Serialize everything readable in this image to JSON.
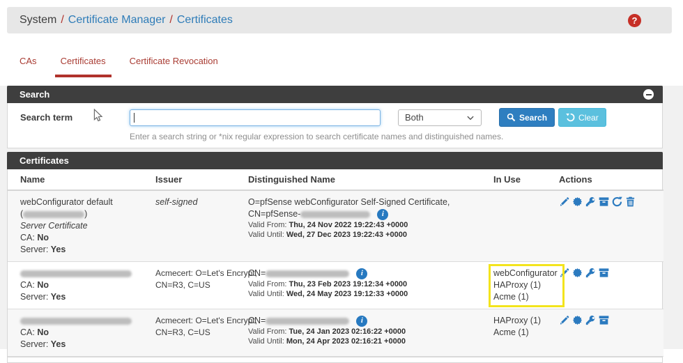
{
  "breadcrumb": {
    "root": "System",
    "separator": "/",
    "link1": "Certificate Manager",
    "link2": "Certificates",
    "help_icon": "?"
  },
  "tabs": {
    "cas": "CAs",
    "certificates": "Certificates",
    "revocation": "Certificate Revocation",
    "active": "Certificates"
  },
  "search": {
    "title": "Search",
    "term_label": "Search term",
    "input_value": "",
    "scope_value": "Both",
    "search_button": "Search",
    "clear_button": "Clear",
    "help_text": "Enter a search string or *nix regular expression to search certificate names and distinguished names."
  },
  "labels": {
    "ca": "CA:",
    "server": "Server:",
    "valid_from": "Valid From:",
    "valid_until": "Valid Until:"
  },
  "table": {
    "title": "Certificates",
    "columns": {
      "name": "Name",
      "issuer": "Issuer",
      "dn": "Distinguished Name",
      "in_use": "In Use",
      "actions": "Actions"
    },
    "rows": [
      {
        "name": "webConfigurator default",
        "paren_open": "(",
        "name_redacted": true,
        "paren_close": ")",
        "type": "Server Certificate",
        "ca_value": "No",
        "server_value": "Yes",
        "issuer": "self-signed",
        "dn_line1": "O=pfSense webConfigurator Self-Signed Certificate,",
        "dn_prefix": "CN=pfSense-",
        "dn_redacted": true,
        "valid_from": "Thu, 24 Nov 2022 19:22:43 +0000",
        "valid_until": "Wed, 27 Dec 2023 19:22:43 +0000",
        "in_use": [],
        "actions": [
          "edit",
          "export-certificate",
          "export-key",
          "export-p12",
          "renew",
          "delete"
        ]
      },
      {
        "name_redacted": true,
        "ca_value": "No",
        "server_value": "Yes",
        "issuer_line1": "Acmecert: O=Let's Encrypt,",
        "issuer_line2": "CN=R3, C=US",
        "dn_prefix": "CN=",
        "dn_redacted": true,
        "valid_from": "Thu, 23 Feb 2023 19:12:34 +0000",
        "valid_until": "Wed, 24 May 2023 19:12:33 +0000",
        "in_use": [
          "webConfigurator",
          "HAProxy (1)",
          "Acme (1)"
        ],
        "highlighted": true,
        "actions": [
          "edit",
          "export-certificate",
          "export-key",
          "export-p12"
        ]
      },
      {
        "name_redacted": true,
        "ca_value": "No",
        "server_value": "Yes",
        "issuer_line1": "Acmecert: O=Let's Encrypt,",
        "issuer_line2": "CN=R3, C=US",
        "dn_prefix": "CN=",
        "dn_redacted": true,
        "valid_from": "Tue, 24 Jan 2023 02:16:22 +0000",
        "valid_until": "Mon, 24 Apr 2023 02:16:21 +0000",
        "in_use": [
          "HAProxy (1)",
          "Acme (1)"
        ],
        "actions": [
          "edit",
          "export-certificate",
          "export-key",
          "export-p12"
        ]
      }
    ]
  },
  "colors": {
    "panel_header": "#3e3e3e",
    "accent_blue": "#2e7ec0",
    "clear_blue": "#5bc0de",
    "tab_red": "#b0322c",
    "help_red": "#c62f26",
    "info_blue": "#2779c0",
    "highlight_yellow": "#f3e41d",
    "action_icon_blue": "#2b7abf"
  }
}
